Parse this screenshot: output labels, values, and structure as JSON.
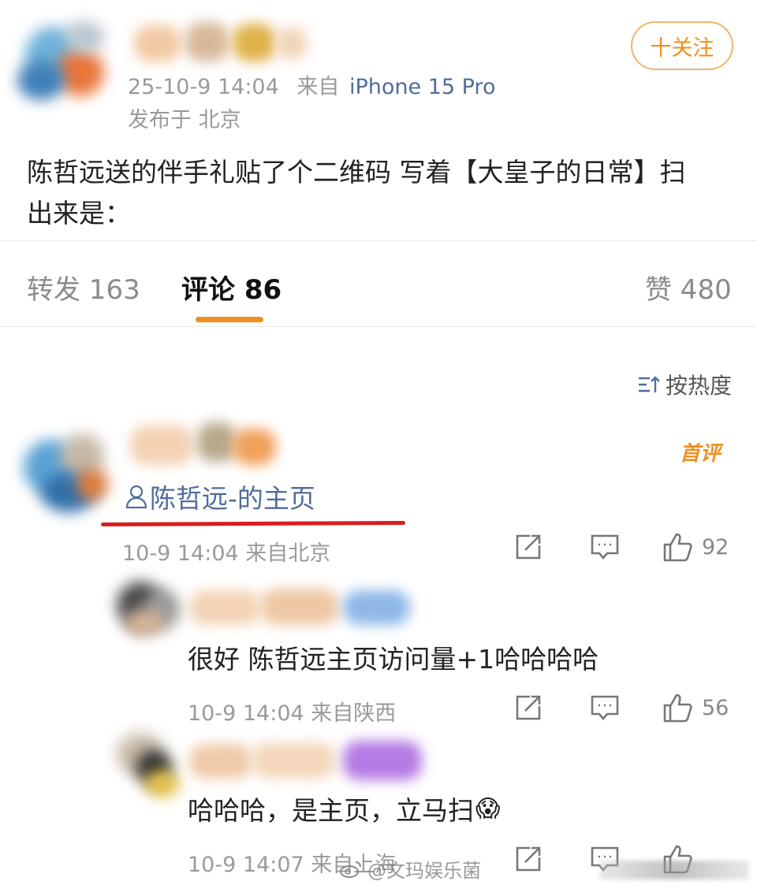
{
  "post": {
    "time": "25-10-9 14:04",
    "source_prefix": "来自",
    "device": "iPhone 15 Pro",
    "location": "发布于 北京",
    "follow_label": "十关注",
    "text_line1": "陈哲远送的伴手礼贴了个二维码 写着【大皇子的日常】扫",
    "text_line2": "出来是："
  },
  "tabs": {
    "repost": "转发 163",
    "comments": "评论 86",
    "likes": "赞 480"
  },
  "sort": {
    "label": "按热度"
  },
  "comments": [
    {
      "badge": "首评",
      "link_text": "陈哲远-的主页",
      "meta": "10-9 14:04 来自北京",
      "likes": "92"
    },
    {
      "text": "很好 陈哲远主页访问量+1哈哈哈哈",
      "meta": "10-9 14:04 来自陕西",
      "likes": "56"
    },
    {
      "text": "哈哈哈，是主页，立马扫",
      "emoji": "😱",
      "meta": "10-9 14:07 来自上海"
    }
  ],
  "watermark": "@文玛娱乐菌",
  "colors": {
    "accent_orange": "#f08f1f",
    "link_blue": "#4f6d9a",
    "underline_red": "#d81e1e",
    "meta_gray": "#9a9a9a"
  }
}
